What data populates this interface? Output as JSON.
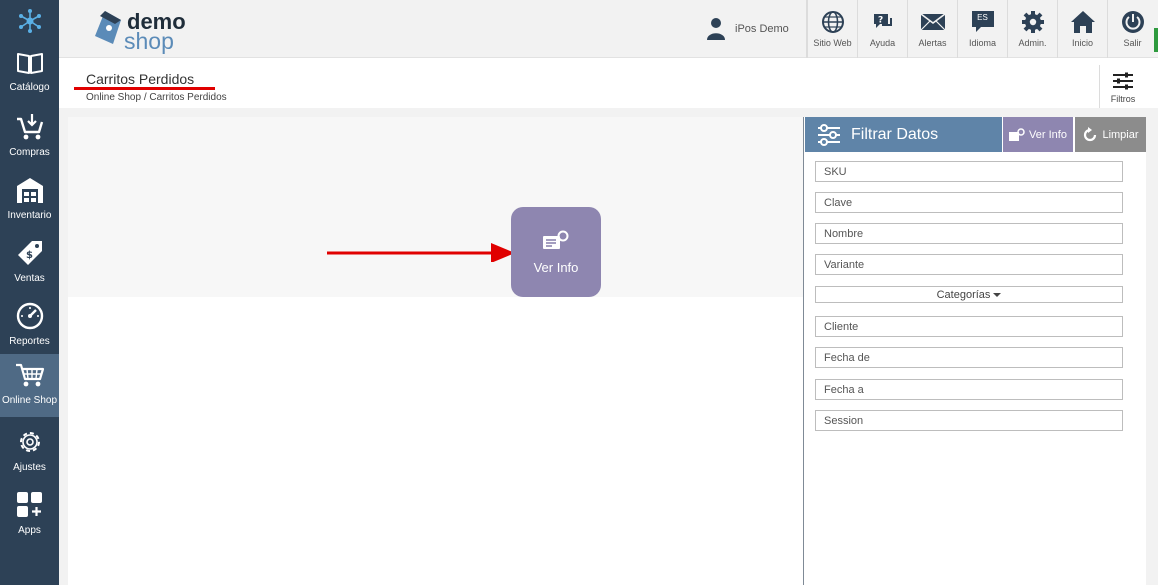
{
  "sidebar": {
    "items": [
      {
        "label": "Catálogo",
        "icon": "book-icon"
      },
      {
        "label": "Compras",
        "icon": "cart-download-icon"
      },
      {
        "label": "Inventario",
        "icon": "warehouse-icon"
      },
      {
        "label": "Ventas",
        "icon": "price-tag-icon"
      },
      {
        "label": "Reportes",
        "icon": "gauge-icon"
      },
      {
        "label": "Online Shop",
        "icon": "shopping-cart-icon",
        "active": true
      },
      {
        "label": "Ajustes",
        "icon": "gear-icon"
      },
      {
        "label": "Apps",
        "icon": "apps-grid-icon"
      }
    ]
  },
  "header": {
    "brand_top": "demo",
    "brand_bottom": "shop",
    "user_name": "iPos Demo",
    "buttons": [
      {
        "label": "Sitio Web",
        "icon": "globe-icon"
      },
      {
        "label": "Ayuda",
        "icon": "help-chat-icon"
      },
      {
        "label": "Alertas",
        "icon": "envelope-icon"
      },
      {
        "label": "Idioma",
        "icon": "language-icon",
        "badge": "ES"
      },
      {
        "label": "Admin.",
        "icon": "gear-icon"
      },
      {
        "label": "Inicio",
        "icon": "home-icon"
      },
      {
        "label": "Salir",
        "icon": "power-icon"
      }
    ]
  },
  "page": {
    "title": "Carritos Perdidos",
    "breadcrumb": "Online Shop / Carritos Perdidos",
    "filters_label": "Filtros"
  },
  "main": {
    "ver_info_label": "Ver Info"
  },
  "filter_panel": {
    "title": "Filtrar Datos",
    "ver_info_label": "Ver Info",
    "clear_label": "Limpiar",
    "fields": {
      "sku": "SKU",
      "clave": "Clave",
      "nombre": "Nombre",
      "variante": "Variante",
      "categorias": "Categorías",
      "cliente": "Cliente",
      "fecha_de": "Fecha de",
      "fecha_a": "Fecha a",
      "session": "Session"
    }
  },
  "colors": {
    "sidebar": "#2d4156",
    "sidebar_active": "#4f6a85",
    "filter_header": "#5f84a8",
    "ver_info": "#8e86b0",
    "clear": "#8c8c8c",
    "annotation": "#e00000"
  }
}
